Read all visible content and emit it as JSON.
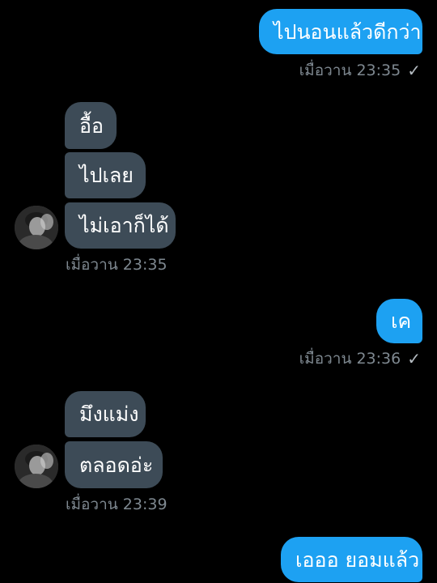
{
  "messages": [
    {
      "id": "m1",
      "direction": "out",
      "text": "ไปนอนแล้วดีกว่า",
      "time": "เมื่อวาน 23:35",
      "read": true
    },
    {
      "id": "m2",
      "direction": "in",
      "text": "อื้อ"
    },
    {
      "id": "m3",
      "direction": "in",
      "text": "ไปเลย"
    },
    {
      "id": "m4",
      "direction": "in",
      "text": "ไม่เอาก็ได้",
      "time": "เมื่อวาน 23:35"
    },
    {
      "id": "m5",
      "direction": "out",
      "text": "เค",
      "time": "เมื่อวาน 23:36",
      "read": true
    },
    {
      "id": "m6",
      "direction": "in",
      "text": "มึงแม่ง"
    },
    {
      "id": "m7",
      "direction": "in",
      "text": "ตลอดอ่ะ",
      "time": "เมื่อวาน 23:39"
    },
    {
      "id": "m8",
      "direction": "out",
      "text": "เอออ ยอมแล้ว"
    }
  ],
  "read_receipt_glyph": "✓",
  "colors": {
    "background": "#000000",
    "outgoing_bubble": "#1da1f2",
    "incoming_bubble": "#3d4b57",
    "timestamp": "#7e8890"
  },
  "icons": {
    "avatar": "contact-avatar-photo",
    "read_receipt": "check-icon"
  }
}
